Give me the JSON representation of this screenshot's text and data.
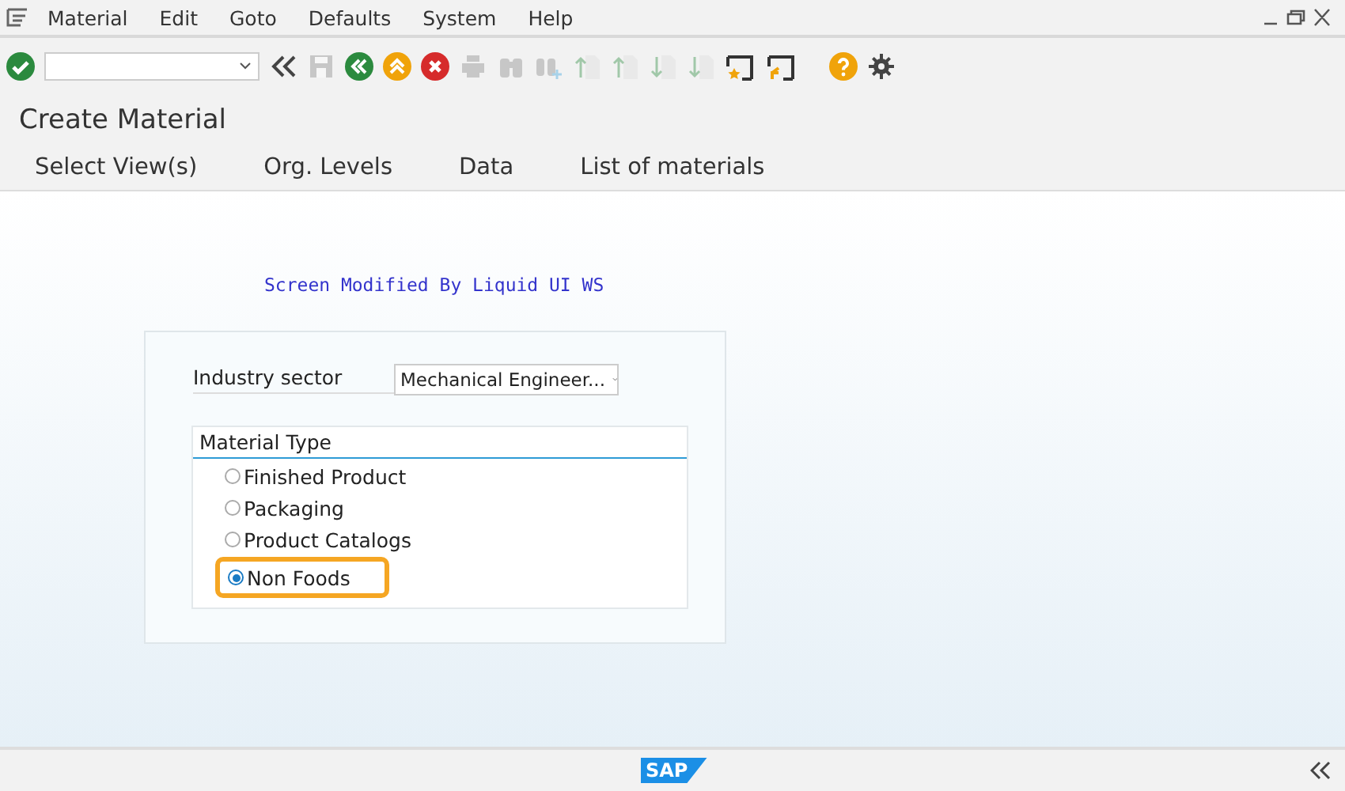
{
  "menu": [
    "Material",
    "Edit",
    "Goto",
    "Defaults",
    "System",
    "Help"
  ],
  "toolbar": [
    {
      "kind": "enter",
      "disabled": false
    },
    {
      "kind": "command"
    },
    {
      "kind": "collapse",
      "disabled": false
    },
    {
      "kind": "save",
      "disabled": true
    },
    {
      "kind": "back",
      "disabled": false
    },
    {
      "kind": "exit",
      "disabled": false
    },
    {
      "kind": "cancel",
      "disabled": false
    },
    {
      "kind": "print",
      "disabled": true
    },
    {
      "kind": "find",
      "disabled": true
    },
    {
      "kind": "find-next",
      "disabled": true
    },
    {
      "kind": "page-up",
      "disabled": true
    },
    {
      "kind": "page-up",
      "disabled": true
    },
    {
      "kind": "page-down",
      "disabled": true
    },
    {
      "kind": "page-down",
      "disabled": true
    },
    {
      "kind": "new-session",
      "disabled": false
    },
    {
      "kind": "shortcut",
      "disabled": false
    },
    {
      "kind": "help",
      "disabled": false
    },
    {
      "kind": "settings",
      "disabled": false
    }
  ],
  "title": "Create Material",
  "app_toolbar": [
    "Select View(s)",
    "Org. Levels",
    "Data",
    "List of materials"
  ],
  "banner": "Screen Modified By Liquid UI WS",
  "industry_sector": {
    "label": "Industry sector",
    "value": "Mechanical Engineer..."
  },
  "material_type": {
    "title": "Material Type",
    "options": [
      {
        "label": "Finished Product",
        "selected": false,
        "highlighted": false
      },
      {
        "label": "Packaging",
        "selected": false,
        "highlighted": false
      },
      {
        "label": "Product Catalogs",
        "selected": false,
        "highlighted": false
      },
      {
        "label": "Non Foods",
        "selected": true,
        "highlighted": true
      }
    ]
  },
  "status_bar": {
    "logo": "SAP"
  }
}
